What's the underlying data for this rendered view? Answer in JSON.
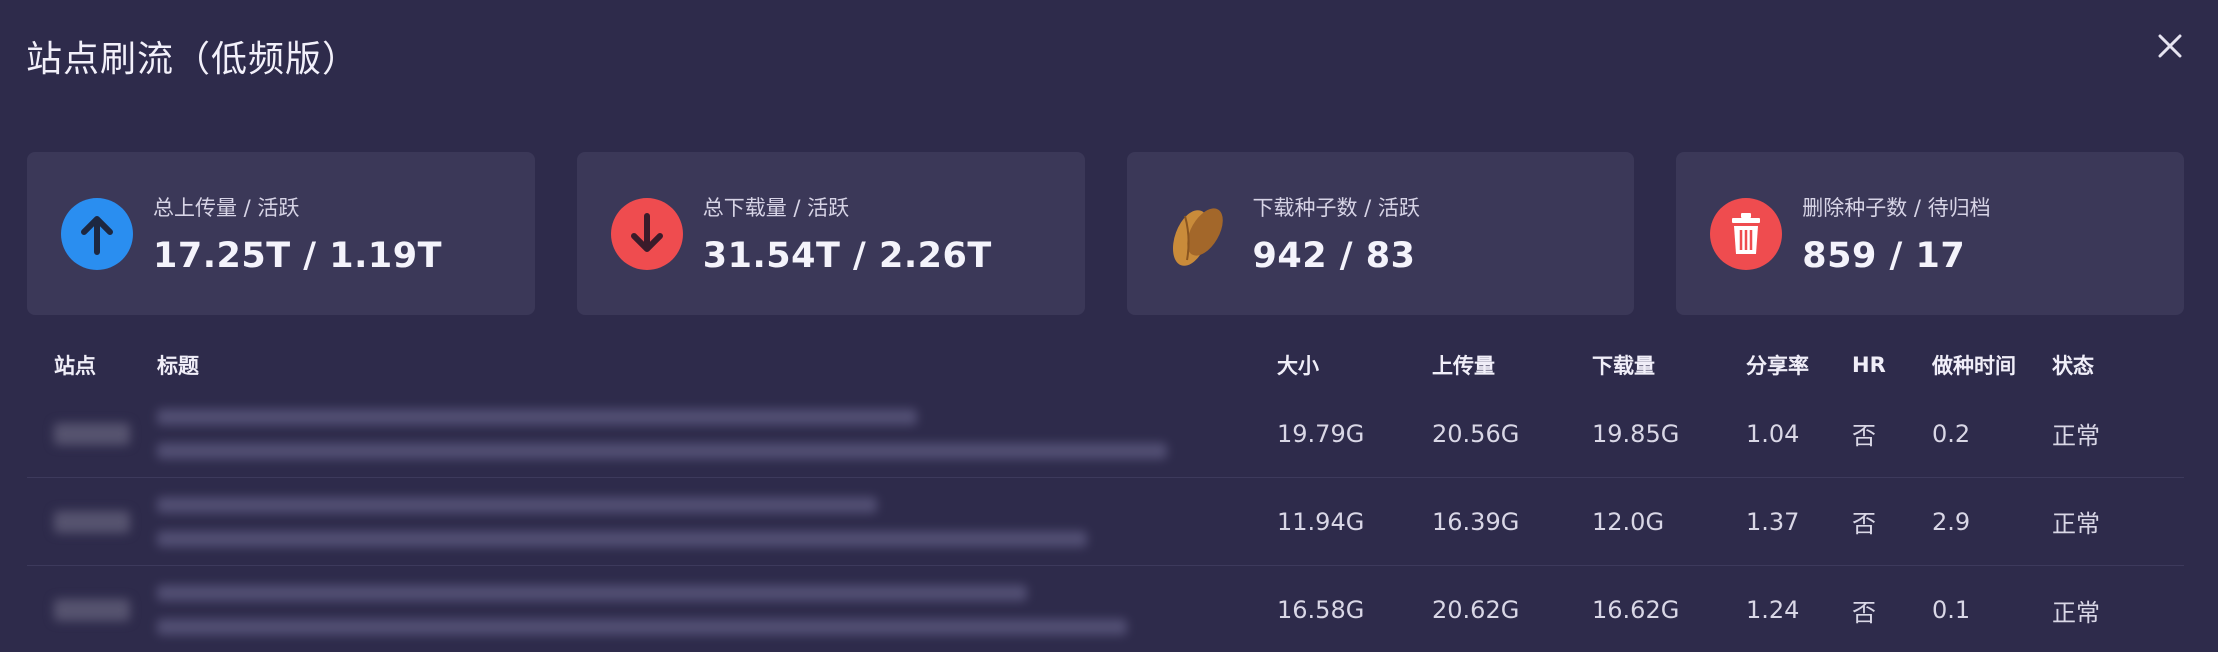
{
  "dialog": {
    "title": "站点刷流（低频版）"
  },
  "cards": [
    {
      "label": "总上传量 / 活跃",
      "value": "17.25T / 1.19T",
      "icon": "upload-arrow-icon",
      "color": "#2a8ef0"
    },
    {
      "label": "总下载量 / 活跃",
      "value": "31.54T / 2.26T",
      "icon": "download-arrow-icon",
      "color": "#ef4c4f"
    },
    {
      "label": "下载种子数 / 活跃",
      "value": "942 / 83",
      "icon": "seed-icon",
      "color": "#c98b3a"
    },
    {
      "label": "删除种子数 / 待归档",
      "value": "859 / 17",
      "icon": "trash-icon",
      "color": "#ef4c4f"
    }
  ],
  "table": {
    "headers": {
      "site": "站点",
      "title": "标题",
      "size": "大小",
      "upload": "上传量",
      "download": "下载量",
      "ratio": "分享率",
      "hr": "HR",
      "seed_time": "做种时间",
      "status": "状态"
    },
    "rows": [
      {
        "size": "19.79G",
        "upload": "20.56G",
        "download": "19.85G",
        "ratio": "1.04",
        "hr": "否",
        "seed_time": "0.2",
        "status": "正常"
      },
      {
        "size": "11.94G",
        "upload": "16.39G",
        "download": "12.0G",
        "ratio": "1.37",
        "hr": "否",
        "seed_time": "2.9",
        "status": "正常"
      },
      {
        "size": "16.58G",
        "upload": "20.62G",
        "download": "16.62G",
        "ratio": "1.24",
        "hr": "否",
        "seed_time": "0.1",
        "status": "正常"
      }
    ]
  }
}
